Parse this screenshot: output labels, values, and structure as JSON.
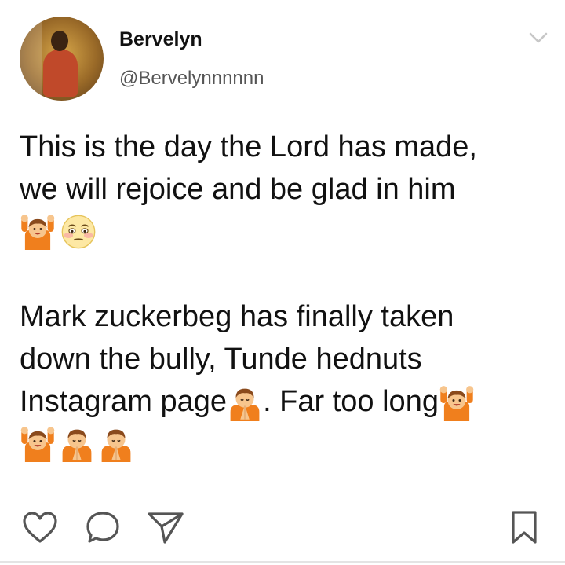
{
  "user": {
    "name": "Bervelyn",
    "handle": "@Bervelynnnnnn"
  },
  "tweet": {
    "line1": "This is the day the Lord has made,",
    "line2": "we will rejoice and be glad in him",
    "line3": "Mark zuckerbeg has finally taken",
    "line4": "down the bully, Tunde hednuts",
    "line5a": "Instagram page",
    "line5b": ". Far too long"
  },
  "icons": {
    "menu": "chevron-down-icon",
    "like": "heart-icon",
    "reply": "comment-icon",
    "share": "send-icon",
    "save": "bookmark-icon",
    "emoji_raise": "person-raising-hands-emoji",
    "emoji_pray": "person-praying-emoji",
    "emoji_flushed": "flushed-face-emoji"
  },
  "colors": {
    "emoji_orange": "#f07f1d",
    "emoji_skin": "#f7c58d",
    "icon_gray": "#555555",
    "chevron_gray": "#c7c7c7"
  }
}
